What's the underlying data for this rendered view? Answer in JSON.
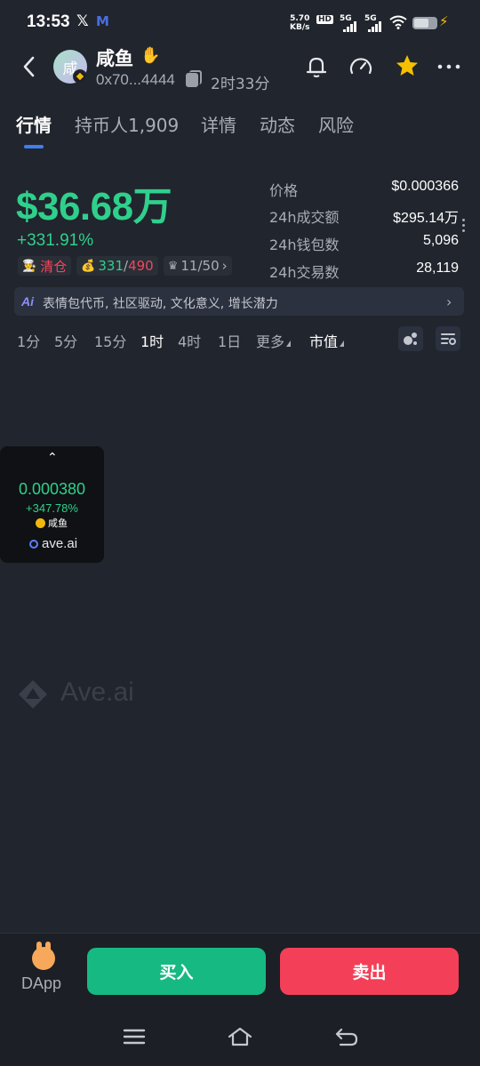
{
  "status_bar": {
    "time": "13:53",
    "x_glyph": "𝕏",
    "m_glyph": "M",
    "speed_value": "5.70",
    "speed_unit": "KB/s",
    "hd": "HD",
    "network1": "5G",
    "network2": "5G"
  },
  "header": {
    "avatar_text": "咸",
    "token_name": "咸鱼",
    "address": "0x70...4444",
    "age": "2时33分"
  },
  "tabs": [
    {
      "label": "行情",
      "active": true
    },
    {
      "label": "持币人1,909",
      "active": false
    },
    {
      "label": "详情",
      "active": false
    },
    {
      "label": "动态",
      "active": false
    },
    {
      "label": "风险",
      "active": false
    }
  ],
  "summary": {
    "market_cap": "$36.68万",
    "change": "+331.91%",
    "tag_clear": "清仓",
    "tag_holders_a": "331",
    "tag_holders_sep": "/",
    "tag_holders_b": "490",
    "tag_rank": "11/50"
  },
  "stats": [
    {
      "label": "价格",
      "value": "$0.000366"
    },
    {
      "label": "24h成交额",
      "value": "$295.14万"
    },
    {
      "label": "24h钱包数",
      "value": "5,096"
    },
    {
      "label": "24h交易数",
      "value": "28,119"
    }
  ],
  "ai_banner": {
    "icon_text": "Ai",
    "text": "表情包代币, 社区驱动, 文化意义, 增长潜力"
  },
  "intervals": [
    {
      "label": "1分",
      "active": false
    },
    {
      "label": "5分",
      "active": false
    },
    {
      "label": "15分",
      "active": false
    },
    {
      "label": "1时",
      "active": true
    },
    {
      "label": "4时",
      "active": false
    },
    {
      "label": "1日",
      "active": false
    }
  ],
  "more_label": "更多",
  "metric_label": "市值",
  "popup_card": {
    "price": "0.000380",
    "change": "+347.78%",
    "token": "咸鱼",
    "brand": "ave.ai"
  },
  "watermark": "Ave.ai",
  "bottom": {
    "dapp_label": "DApp",
    "buy_label": "买入",
    "sell_label": "卖出"
  },
  "colors": {
    "background": "#21252d",
    "up_green": "#2fd08c",
    "buy_green": "#17b982",
    "sell_red": "#f34058",
    "accent_blue": "#3f7ef0",
    "star_yellow": "#f5c000"
  },
  "icons": [
    "back-arrow-icon",
    "bell-icon",
    "gauge-icon",
    "star-icon",
    "more-icon",
    "copy-icon",
    "chart-bubble-icon",
    "chart-settings-icon",
    "menu-icon",
    "home-icon",
    "return-icon"
  ]
}
